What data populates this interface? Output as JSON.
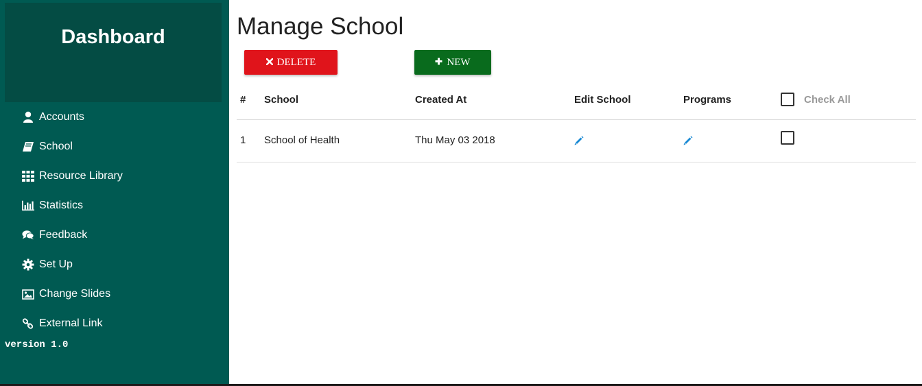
{
  "sidebar": {
    "title": "Dashboard",
    "items": [
      {
        "label": "Accounts",
        "icon": "user-icon"
      },
      {
        "label": "School",
        "icon": "book-icon"
      },
      {
        "label": "Resource Library",
        "icon": "grid-icon"
      },
      {
        "label": "Statistics",
        "icon": "bar-chart-icon"
      },
      {
        "label": "Feedback",
        "icon": "comments-icon"
      },
      {
        "label": "Set Up",
        "icon": "gear-icon"
      },
      {
        "label": "Change Slides",
        "icon": "image-icon"
      },
      {
        "label": "External Link",
        "icon": "link-icon"
      }
    ],
    "version": "version 1.0"
  },
  "main": {
    "title": "Manage School",
    "delete_label": "DELETE",
    "new_label": "NEW",
    "table": {
      "headers": [
        "#",
        "School",
        "Created At",
        "Edit School",
        "Programs"
      ],
      "check_all_label": "Check All",
      "rows": [
        {
          "num": "1",
          "school": "School of Health",
          "created": "Thu May 03 2018"
        }
      ]
    }
  },
  "colors": {
    "sidebar_bg": "#005a52",
    "sidebar_header_bg": "#044c44",
    "delete_bg": "#e0141b",
    "new_bg": "#096b1d",
    "pencil": "#1a8ad4"
  }
}
